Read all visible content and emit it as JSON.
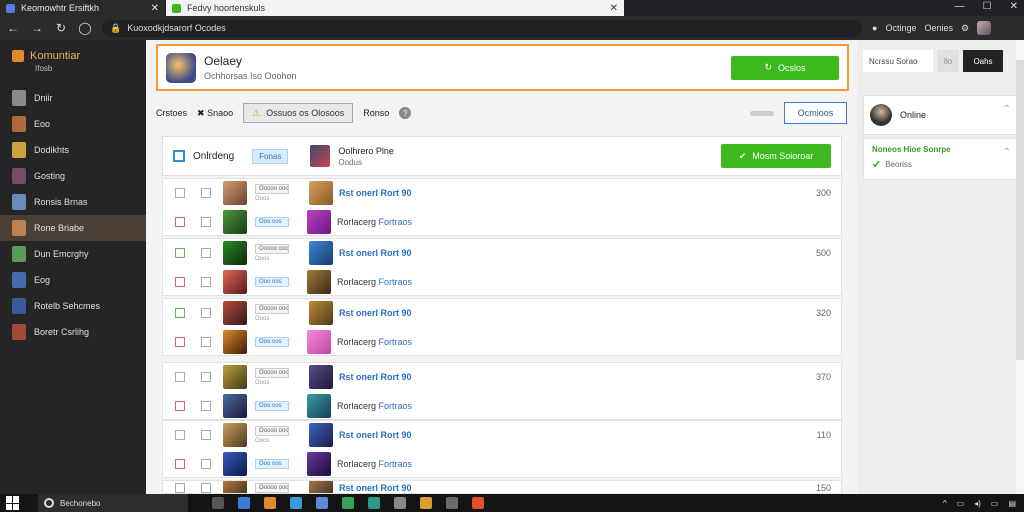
{
  "browser": {
    "tab1_title": "Keomowhtr Ersiftkh",
    "tab2_title": "Fedvy hoortenskuls",
    "url": "Kuoxodkjdsarorf Ocodes",
    "account_label": "Octinge",
    "account_name": "Oenies"
  },
  "sidebar": {
    "brand": "Komuntiar",
    "brand_sub": "Ifosb",
    "items": [
      {
        "label": "Dniir"
      },
      {
        "label": "Eoo"
      },
      {
        "label": "Dodikhts"
      },
      {
        "label": "Gosting"
      },
      {
        "label": "Ronsis Brnas"
      },
      {
        "label": "Rone Briabe"
      },
      {
        "label": "Dun Emcrghy"
      },
      {
        "label": "Eog"
      },
      {
        "label": "Rotelb Sehcmes"
      },
      {
        "label": "Boretr Csrlihg"
      }
    ]
  },
  "header": {
    "title": "Oelaey",
    "subtitle": "Ochhorsas Iso Ooohon",
    "button": "Ocslos"
  },
  "filters": {
    "f1": "Crstoes",
    "f2": "Snaoo",
    "warn": "Ossuos os Olosoos",
    "f3": "Ronso",
    "button": "Ocmioos"
  },
  "card": {
    "title": "Onlrdeng",
    "tag": "Fonas",
    "name": "Oolhrero Plne",
    "sub": "Oodus",
    "button": "Mosm Soioroar"
  },
  "groups": [
    {
      "value": "300",
      "row1_name": "Rst onerl Rort 90",
      "row2_name": "Rorlacerg",
      "row2_link": "Fortraos"
    },
    {
      "value": "500",
      "row1_name": "Rst onerl Rort 90",
      "row2_name": "Rorlacerg",
      "row2_link": "Fortraos"
    },
    {
      "value": "320",
      "row1_name": "Rst onerl Rort 90",
      "row2_name": "Rorlacerg",
      "row2_link": "Fortraos"
    },
    {
      "value": "370",
      "row1_name": "Rst onerl Rort 90",
      "row2_name": "Rorlacerg",
      "row2_link": "Fortraos"
    },
    {
      "value": "110",
      "row1_name": "Rst onerl Rort 90",
      "row2_name": "Rorlacerg",
      "row2_link": "Fortraos"
    },
    {
      "value": "150",
      "row1_name": "Rst onerl Rort 90"
    }
  ],
  "row_tag_gray": "Ooooo ooos",
  "row_tag_sub": "Ooos",
  "row_tag_blue": "Ooo oos",
  "rpanel": {
    "w_label": "Ncrssu Sorao",
    "g_label": "Ilo",
    "b_label": "Oahs",
    "online": "Online",
    "promo_title": "Noneos Hioe Sonrpe",
    "promo_sub": "Beoriss"
  },
  "taskbar": {
    "search": "Bechonebo"
  },
  "colors": {
    "accent_green": "#3db81e",
    "accent_orange": "#f39a3c",
    "link_blue": "#2a6fc0"
  }
}
